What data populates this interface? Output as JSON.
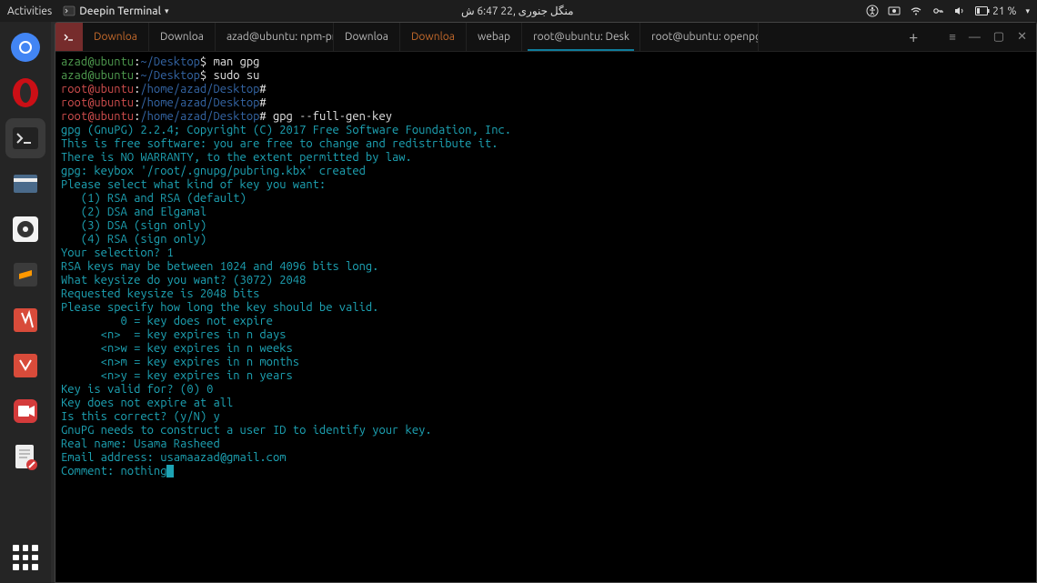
{
  "topbar": {
    "activities": "Activities",
    "app_name": "Deepin Terminal",
    "clock": "منگل جنوری ,22 6:47 ‫ش",
    "battery": "21 %"
  },
  "tabs": [
    {
      "label": "Downloa",
      "highlight": true
    },
    {
      "label": "Downloa"
    },
    {
      "label": "azad@ubuntu: npm-pr"
    },
    {
      "label": "Downloa"
    },
    {
      "label": "Downloa",
      "highlight": true
    },
    {
      "label": "webap"
    },
    {
      "label": "root@ubuntu: Desk",
      "active": true
    },
    {
      "label": "root@ubuntu: openpgp-rev"
    }
  ],
  "terminal": {
    "lines": [
      [
        {
          "cls": "c-green",
          "t": "azad@ubuntu"
        },
        {
          "cls": "c-white",
          "t": ":"
        },
        {
          "cls": "c-blue",
          "t": "~/Desktop"
        },
        {
          "cls": "c-white",
          "t": "$ man gpg"
        }
      ],
      [
        {
          "cls": "c-green",
          "t": "azad@ubuntu"
        },
        {
          "cls": "c-white",
          "t": ":"
        },
        {
          "cls": "c-blue",
          "t": "~/Desktop"
        },
        {
          "cls": "c-white",
          "t": "$ sudo su"
        }
      ],
      [
        {
          "cls": "c-red",
          "t": "root@ubuntu"
        },
        {
          "cls": "c-white",
          "t": ":"
        },
        {
          "cls": "c-blue",
          "t": "/home/azad/Desktop"
        },
        {
          "cls": "c-white",
          "t": "#"
        }
      ],
      [
        {
          "cls": "c-red",
          "t": "root@ubuntu"
        },
        {
          "cls": "c-white",
          "t": ":"
        },
        {
          "cls": "c-blue",
          "t": "/home/azad/Desktop"
        },
        {
          "cls": "c-white",
          "t": "#"
        }
      ],
      [
        {
          "cls": "c-red",
          "t": "root@ubuntu"
        },
        {
          "cls": "c-white",
          "t": ":"
        },
        {
          "cls": "c-blue",
          "t": "/home/azad/Desktop"
        },
        {
          "cls": "c-white",
          "t": "# gpg --full-gen-key"
        }
      ],
      [
        {
          "cls": "c-cyan",
          "t": "gpg (GnuPG) 2.2.4; Copyright (C) 2017 Free Software Foundation, Inc."
        }
      ],
      [
        {
          "cls": "c-cyan",
          "t": "This is free software: you are free to change and redistribute it."
        }
      ],
      [
        {
          "cls": "c-cyan",
          "t": "There is NO WARRANTY, to the extent permitted by law."
        }
      ],
      [
        {
          "cls": "",
          "t": ""
        }
      ],
      [
        {
          "cls": "c-cyan",
          "t": "gpg: keybox '/root/.gnupg/pubring.kbx' created"
        }
      ],
      [
        {
          "cls": "c-cyan",
          "t": "Please select what kind of key you want:"
        }
      ],
      [
        {
          "cls": "c-cyan",
          "t": "   (1) RSA and RSA (default)"
        }
      ],
      [
        {
          "cls": "c-cyan",
          "t": "   (2) DSA and Elgamal"
        }
      ],
      [
        {
          "cls": "c-cyan",
          "t": "   (3) DSA (sign only)"
        }
      ],
      [
        {
          "cls": "c-cyan",
          "t": "   (4) RSA (sign only)"
        }
      ],
      [
        {
          "cls": "c-cyan",
          "t": "Your selection? 1"
        }
      ],
      [
        {
          "cls": "c-cyan",
          "t": "RSA keys may be between 1024 and 4096 bits long."
        }
      ],
      [
        {
          "cls": "c-cyan",
          "t": "What keysize do you want? (3072) 2048"
        }
      ],
      [
        {
          "cls": "c-cyan",
          "t": "Requested keysize is 2048 bits"
        }
      ],
      [
        {
          "cls": "c-cyan",
          "t": "Please specify how long the key should be valid."
        }
      ],
      [
        {
          "cls": "c-cyan",
          "t": "         0 = key does not expire"
        }
      ],
      [
        {
          "cls": "c-cyan",
          "t": "      <n>  = key expires in n days"
        }
      ],
      [
        {
          "cls": "c-cyan",
          "t": "      <n>w = key expires in n weeks"
        }
      ],
      [
        {
          "cls": "c-cyan",
          "t": "      <n>m = key expires in n months"
        }
      ],
      [
        {
          "cls": "c-cyan",
          "t": "      <n>y = key expires in n years"
        }
      ],
      [
        {
          "cls": "c-cyan",
          "t": "Key is valid for? (0) 0"
        }
      ],
      [
        {
          "cls": "c-cyan",
          "t": "Key does not expire at all"
        }
      ],
      [
        {
          "cls": "c-cyan",
          "t": "Is this correct? (y/N) y"
        }
      ],
      [
        {
          "cls": "",
          "t": ""
        }
      ],
      [
        {
          "cls": "c-cyan",
          "t": "GnuPG needs to construct a user ID to identify your key."
        }
      ],
      [
        {
          "cls": "",
          "t": ""
        }
      ],
      [
        {
          "cls": "c-cyan",
          "t": "Real name: Usama Rasheed"
        }
      ],
      [
        {
          "cls": "c-cyan",
          "t": "Email address: usamaazad@gmail.com"
        }
      ],
      [
        {
          "cls": "c-cyan",
          "t": "Comment: nothing",
          "cursor": true
        }
      ]
    ]
  }
}
